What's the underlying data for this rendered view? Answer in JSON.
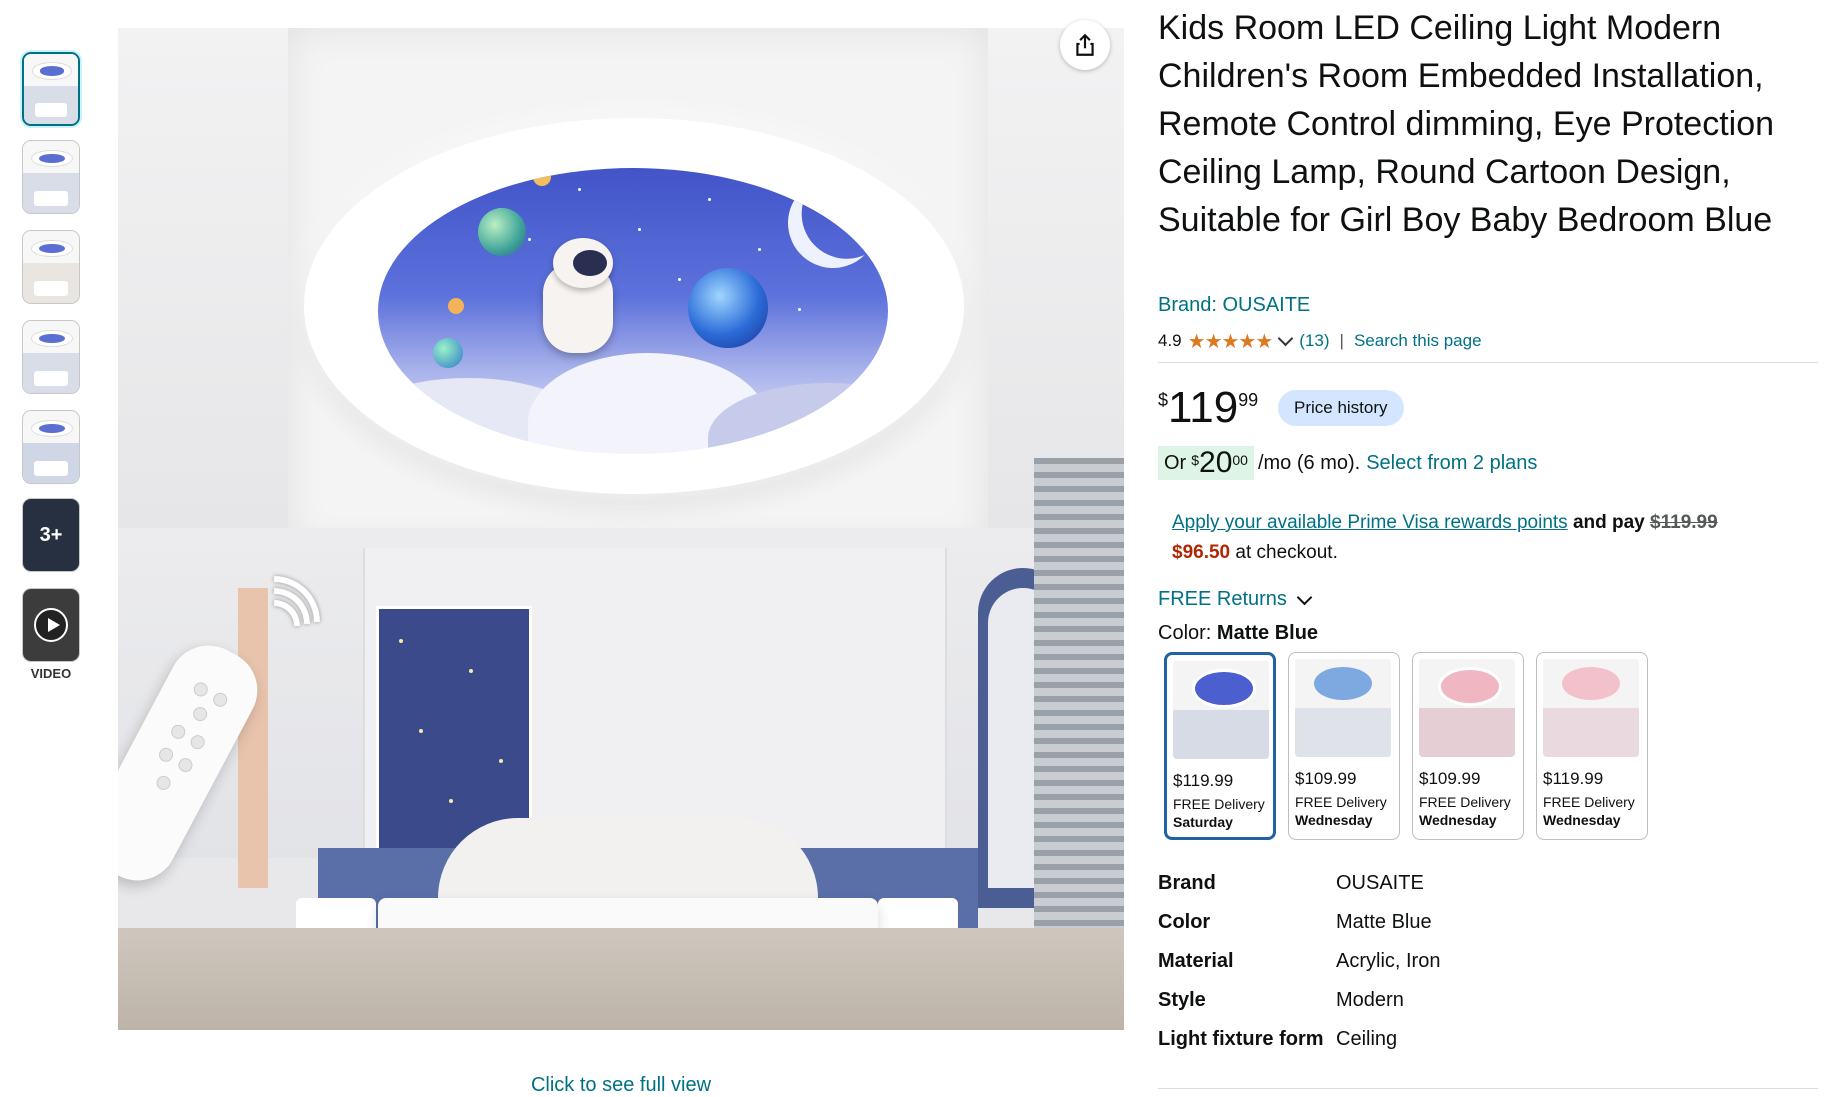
{
  "thumbnails": {
    "more_label": "3+",
    "video_label": "VIDEO"
  },
  "main_image": {
    "full_view_link": "Click to see full view",
    "share_icon": "share-icon"
  },
  "product": {
    "title": "Kids Room LED Ceiling Light Modern Children's Room Embedded Installation, Remote Control dimming, Eye Protection Ceiling Lamp, Round Cartoon Design, Suitable for Girl Boy Baby Bedroom Blue",
    "brand_link": "Brand: OUSAITE",
    "rating_value": "4.9",
    "stars": "★★★★★",
    "review_count": "(13)",
    "search_page": "Search this page"
  },
  "price": {
    "symbol": "$",
    "whole": "119",
    "fraction": "99",
    "price_history": "Price history"
  },
  "monthly": {
    "prefix": "Or",
    "symbol": "$",
    "whole": "20",
    "fraction": "00",
    "suffix": "/mo (6 mo).",
    "plans_link": "Select from 2 plans"
  },
  "prime": {
    "link": "Apply your available Prime Visa rewards points",
    "and_pay": "and pay",
    "old_price": "$119.99",
    "new_price": "$96.50",
    "at_checkout": "at checkout."
  },
  "returns": {
    "label": "FREE Returns"
  },
  "color": {
    "label": "Color:",
    "selected": "Matte Blue",
    "swatches": [
      {
        "price": "$119.99",
        "delivery": "FREE Delivery",
        "day": "Saturday",
        "fixture_color": "#4b5fcf",
        "room_color": "#d7dbe6"
      },
      {
        "price": "$109.99",
        "delivery": "FREE Delivery",
        "day": "Wednesday",
        "fixture_color": "#7ea9e0",
        "room_color": "#dfe2e8"
      },
      {
        "price": "$109.99",
        "delivery": "FREE Delivery",
        "day": "Wednesday",
        "fixture_color": "#f0b7c3",
        "room_color": "#e6cfd4"
      },
      {
        "price": "$119.99",
        "delivery": "FREE Delivery",
        "day": "Wednesday",
        "fixture_color": "#f3c1cc",
        "room_color": "#ead9de"
      }
    ]
  },
  "specs": [
    {
      "key": "Brand",
      "value": "OUSAITE"
    },
    {
      "key": "Color",
      "value": "Matte Blue"
    },
    {
      "key": "Material",
      "value": "Acrylic, Iron"
    },
    {
      "key": "Style",
      "value": "Modern"
    },
    {
      "key": "Light fixture form",
      "value": "Ceiling"
    }
  ],
  "colors": {
    "link": "#007185",
    "price_red": "#b12704",
    "star": "#de7921",
    "selected_border": "#2162a1"
  }
}
